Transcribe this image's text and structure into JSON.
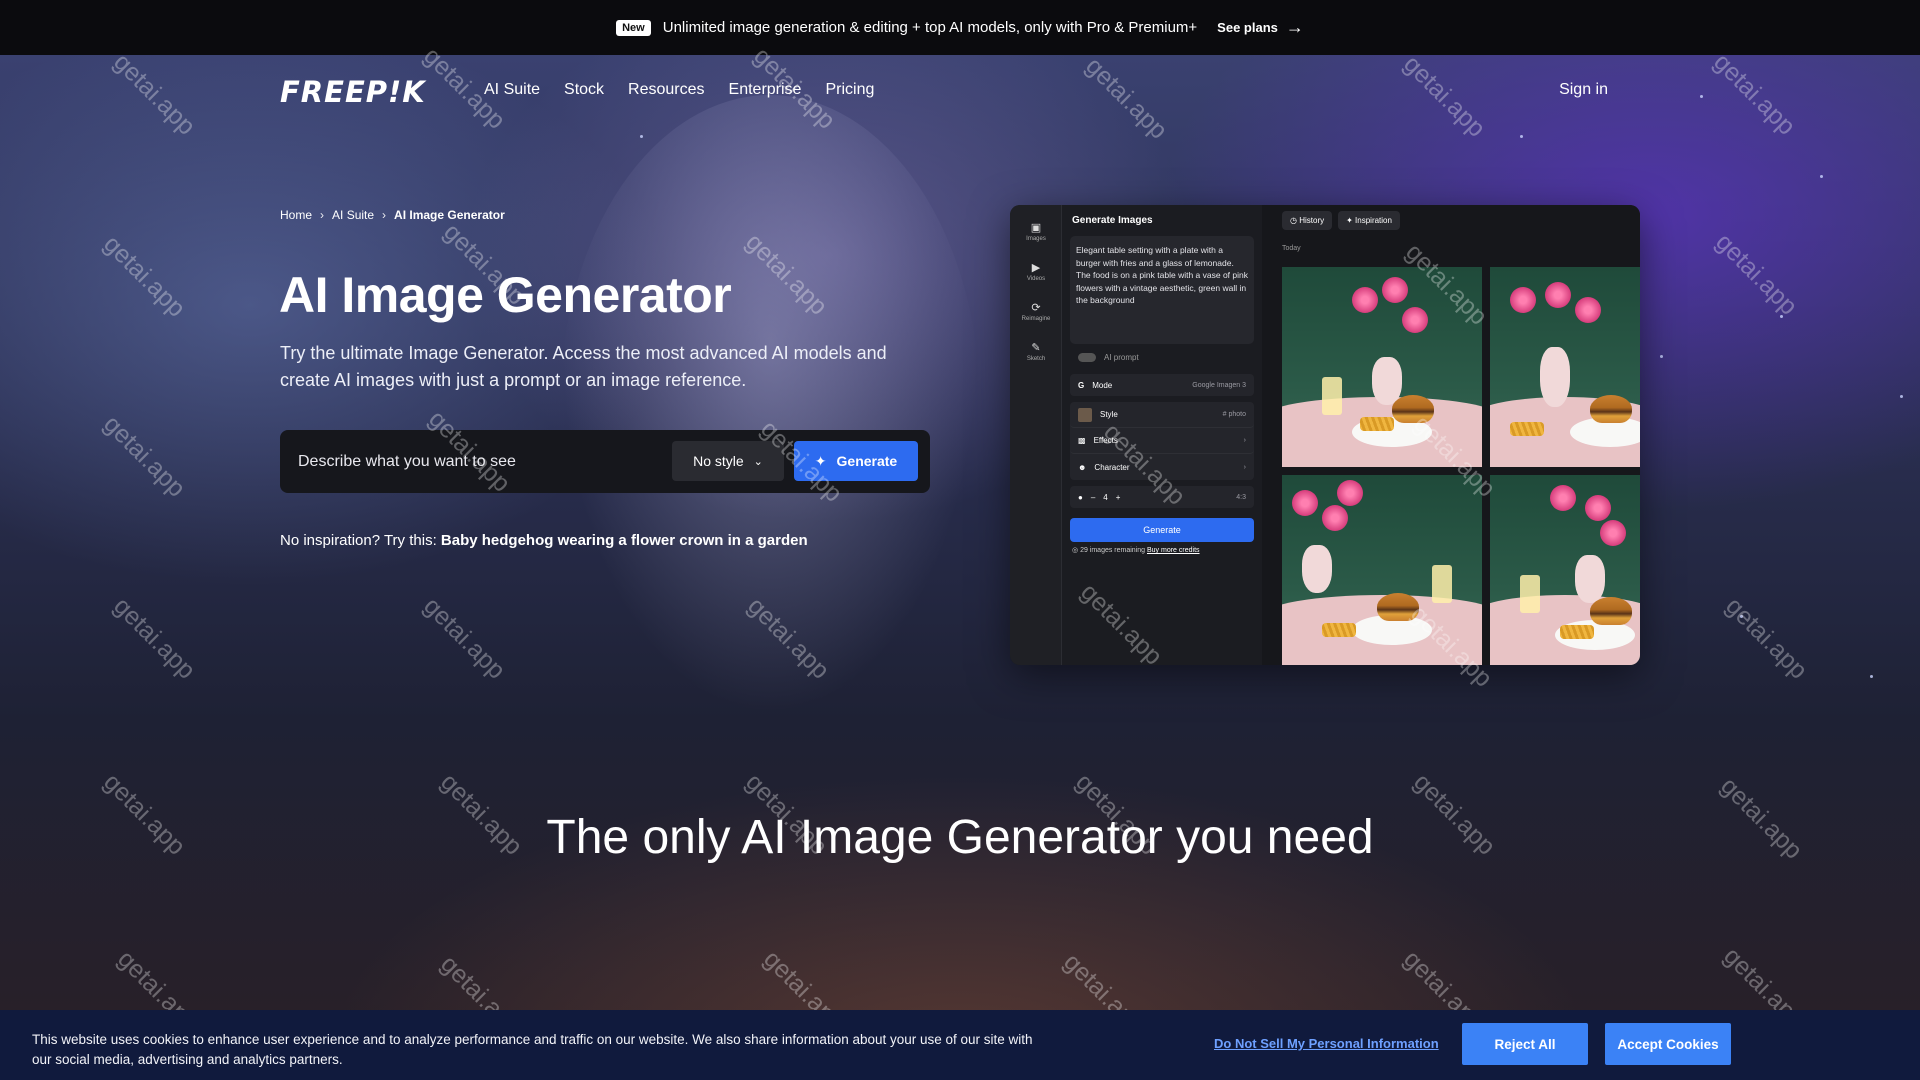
{
  "promo": {
    "badge": "New",
    "message": "Unlimited image generation & editing + top AI models, only with Pro & Premium+",
    "cta": "See plans",
    "cta_icon": "arrow-right-icon"
  },
  "nav": {
    "logo": "FREEP!K",
    "links": [
      "AI Suite",
      "Stock",
      "Resources",
      "Enterprise",
      "Pricing"
    ],
    "sign_in": "Sign in"
  },
  "breadcrumb": [
    "Home",
    "AI Suite",
    "AI Image Generator"
  ],
  "hero": {
    "title": "AI Image Generator",
    "subtitle": "Try the ultimate Image Generator. Access the most advanced AI models and create AI images with just a prompt or an image reference.",
    "prompt_placeholder": "Describe what you want to see",
    "style_select": "No style",
    "generate_label": "Generate",
    "inspiration_prefix": "No inspiration? Try this:",
    "inspiration_example": "Baby hedgehog wearing a flower crown in a garden"
  },
  "mockup": {
    "sidebar": [
      "Images",
      "Videos",
      "Reimagine",
      "Sketch"
    ],
    "panel_title": "Generate Images",
    "prompt_text": "Elegant table setting with a plate with a burger with fries and a glass of lemonade. The food is on a pink table with a vase of pink flowers with a vintage aesthetic, green wall in the background",
    "ai_prompt_label": "AI prompt",
    "mode_label": "Mode",
    "mode_value": "Google Imagen 3",
    "style_label": "Style",
    "style_value": "# photo",
    "effects_label": "Effects",
    "character_label": "Character",
    "count_value": "4",
    "ratio_value": "4:3",
    "generate_label": "Generate",
    "remaining_text": "29 images remaining",
    "buy_credits": "Buy more credits",
    "tabs": [
      "History",
      "Inspiration"
    ],
    "today_label": "Today"
  },
  "section_heading": "The only AI Image Generator you need",
  "watermark_text": "getai.app",
  "cookie": {
    "text": "This website uses cookies to enhance user experience and to analyze performance and traffic on our website. We also share information about your use of our site with our social media, advertising and analytics partners.",
    "do_not_sell": "Do Not Sell My Personal Information",
    "reject": "Reject All",
    "accept": "Accept Cookies"
  },
  "colors": {
    "accent": "#2d6bf0",
    "cookie_bg": "#101a3d",
    "cookie_button": "#3b82f6",
    "promo_bg": "#0b0b0e"
  }
}
